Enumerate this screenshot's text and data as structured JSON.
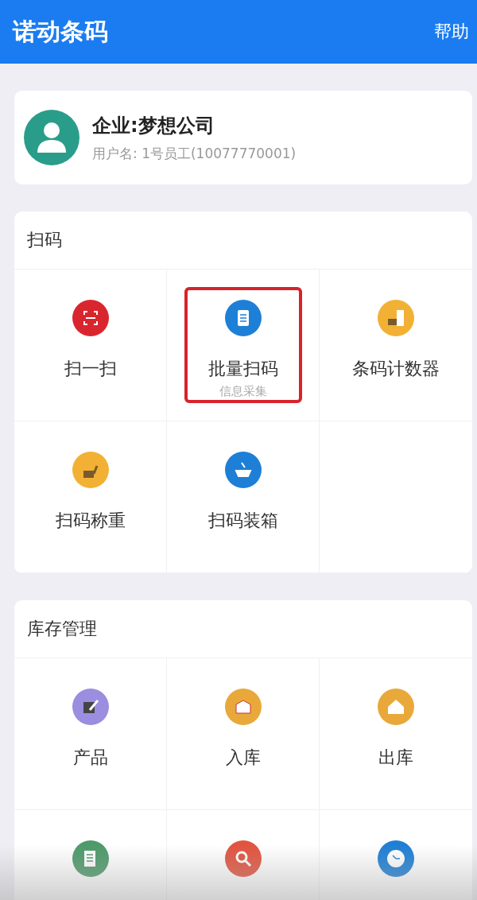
{
  "header": {
    "title": "诺动条码",
    "action": "帮助"
  },
  "profile": {
    "company": "企业:梦想公司",
    "user": "用户名: 1号员工(10077770001)"
  },
  "sections": [
    {
      "title": "扫码",
      "tiles": [
        {
          "label": "扫一扫",
          "color": "#d9262e",
          "highlighted": false
        },
        {
          "label": "批量扫码",
          "sublabel": "信息采集",
          "color": "#1e7fd6",
          "highlighted": true
        },
        {
          "label": "条码计数器",
          "color": "#f2b134",
          "highlighted": false
        },
        {
          "label": "扫码称重",
          "color": "#f2b134",
          "highlighted": false
        },
        {
          "label": "扫码装箱",
          "color": "#1e7fd6",
          "highlighted": false
        }
      ]
    },
    {
      "title": "库存管理",
      "tiles": [
        {
          "label": "产品",
          "color": "#9b8ee0",
          "highlighted": false
        },
        {
          "label": "入库",
          "color": "#e8a93a",
          "highlighted": false
        },
        {
          "label": "出库",
          "color": "#e8a93a",
          "highlighted": false
        },
        {
          "color": "#4e9a6a",
          "highlighted": false
        },
        {
          "color": "#e2543f",
          "highlighted": false
        },
        {
          "color": "#1e7fd6",
          "highlighted": false
        }
      ]
    }
  ]
}
